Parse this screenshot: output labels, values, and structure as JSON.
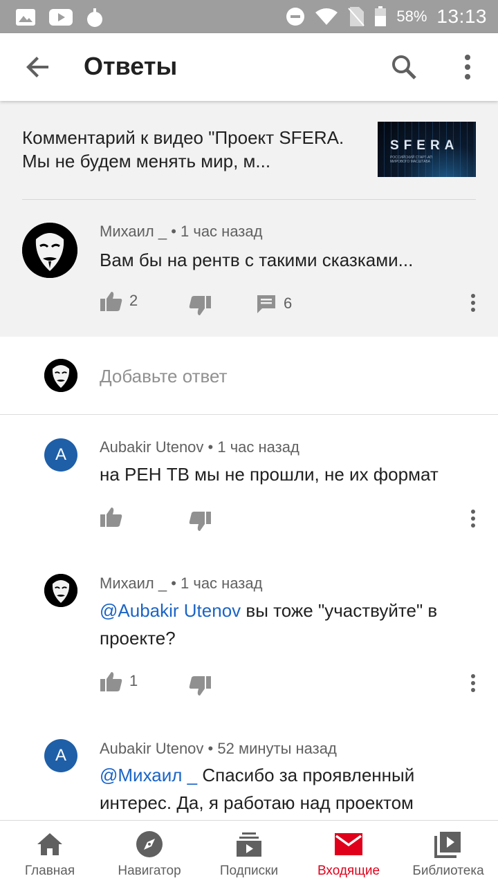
{
  "status_bar": {
    "battery": "58%",
    "time": "13:13"
  },
  "app_bar": {
    "title": "Ответы"
  },
  "video": {
    "title": "Комментарий к видео \"Проект SFERA. Мы не будем менять мир, м...",
    "thumbnail_logo": "SFERA",
    "thumbnail_sub": "РОССИЙСКИЙ СТАРТ-АП МИРОВОГО МАСШТАБА"
  },
  "parent_comment": {
    "author": "Михаил _",
    "time": "1 час назад",
    "text": "Вам бы на рентв с такими сказками...",
    "likes": "2",
    "replies": "6"
  },
  "reply_input": {
    "placeholder": "Добавьте ответ"
  },
  "replies": [
    {
      "avatar_letter": "A",
      "author": "Aubakir Utenov",
      "time": "1 час назад",
      "text": "на РЕН ТВ мы не прошли, не их формат",
      "likes": ""
    },
    {
      "author": "Михаил _",
      "time": "1 час назад",
      "mention": "@Aubakir Utenov",
      "text": " вы тоже \"участвуйте\" в проекте?",
      "likes": "1"
    },
    {
      "avatar_letter": "A",
      "author": "Aubakir Utenov",
      "time": "52 минуты назад",
      "mention": "@Михаил _",
      "text": " Спасибо за проявленный интерес. Да, я работаю над проектом"
    }
  ],
  "bottom_nav": [
    {
      "label": "Главная",
      "icon": "home-icon"
    },
    {
      "label": "Навигатор",
      "icon": "compass-icon"
    },
    {
      "label": "Подписки",
      "icon": "subscriptions-icon"
    },
    {
      "label": "Входящие",
      "icon": "inbox-icon",
      "active": true
    },
    {
      "label": "Библиотека",
      "icon": "library-icon"
    }
  ],
  "colors": {
    "accent_red": "#e0001b",
    "mention_blue": "#1a64c7",
    "avatar_blue": "#1e5fa8"
  }
}
